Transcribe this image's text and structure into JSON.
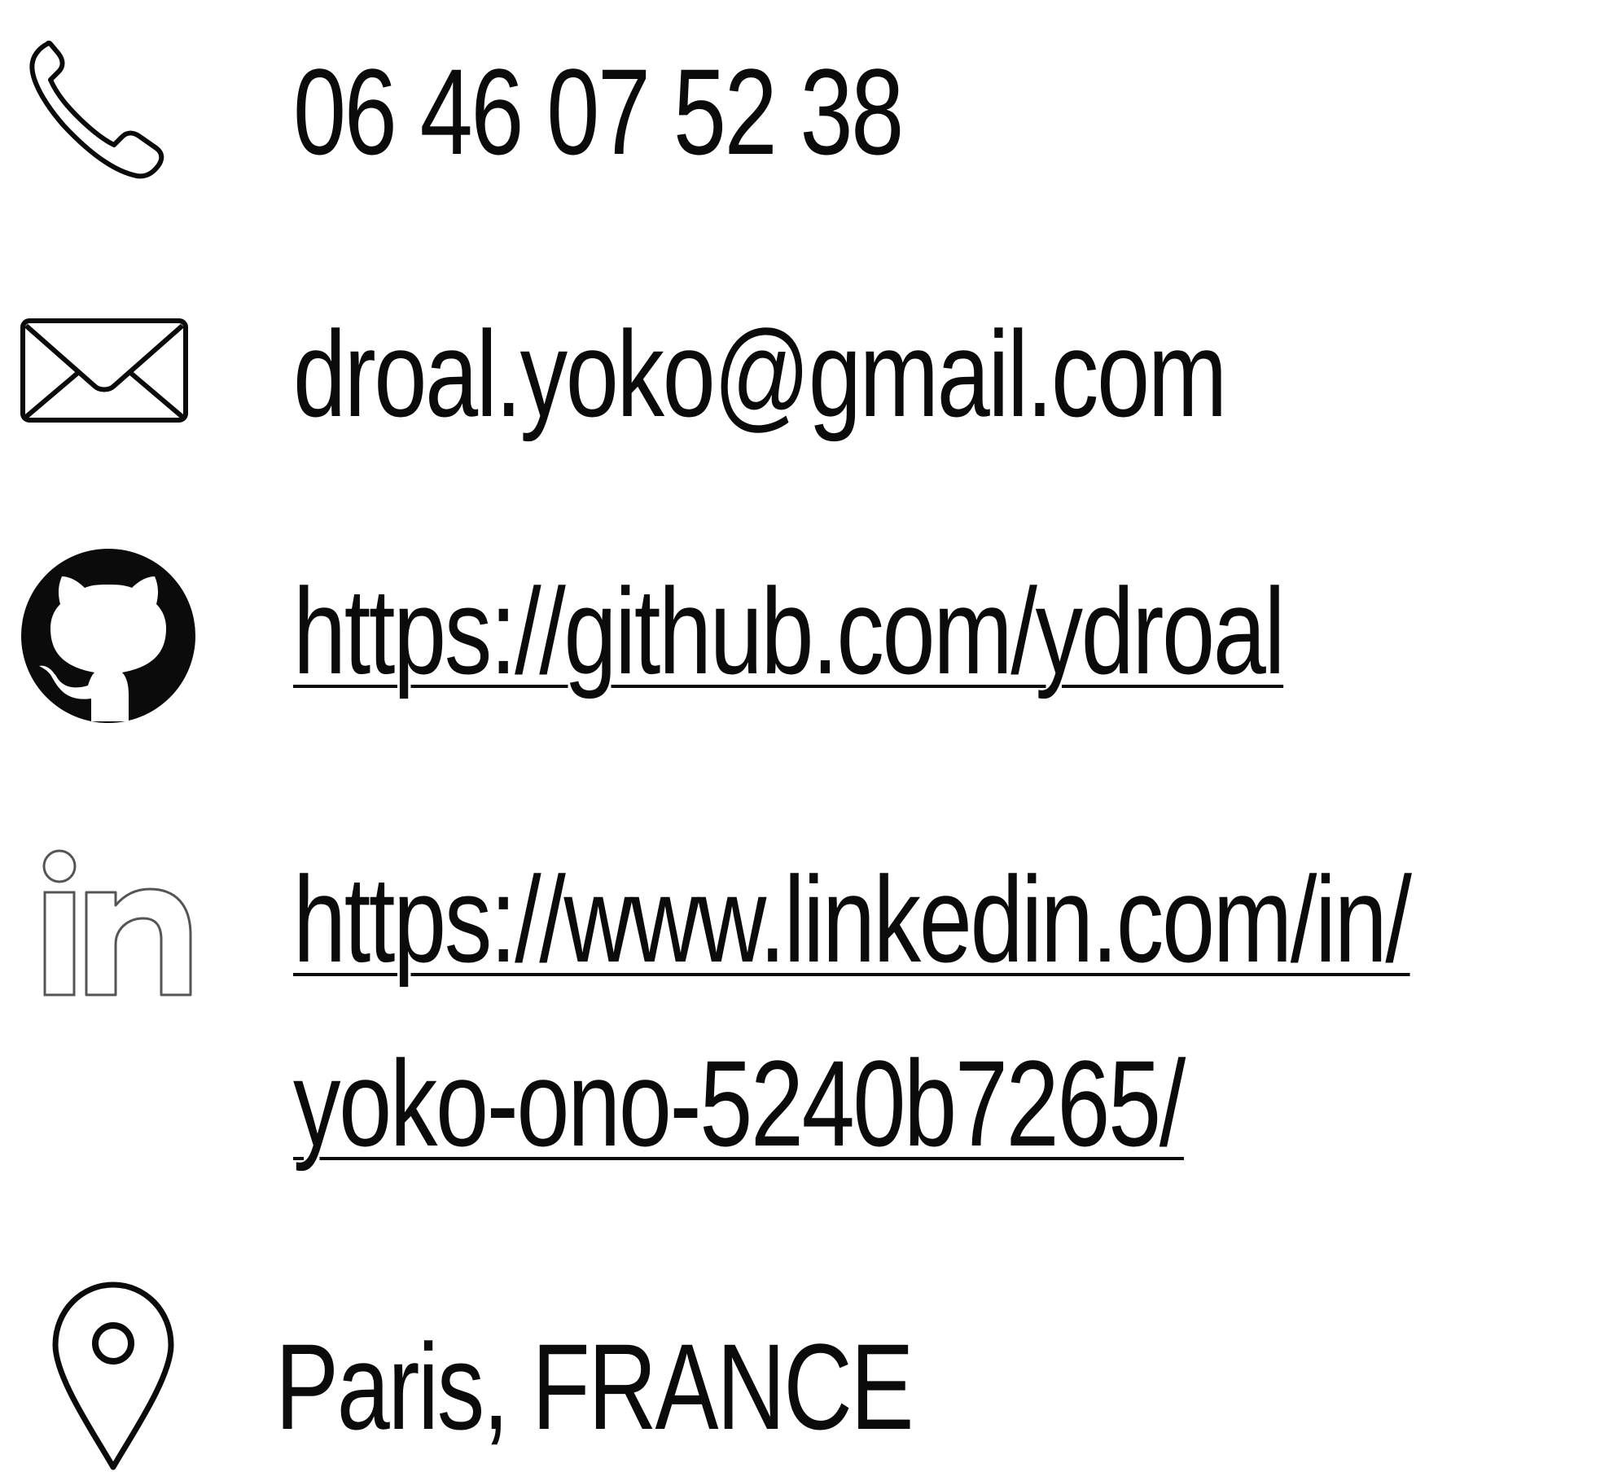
{
  "contact": {
    "phone": {
      "icon": "phone-icon",
      "text": "06 46 07 52 38"
    },
    "email": {
      "icon": "envelope-icon",
      "text": "droal.yoko@gmail.com"
    },
    "github": {
      "icon": "github-icon",
      "text": "https://github.com/ydroal"
    },
    "linkedin": {
      "icon": "linkedin-icon",
      "line1": "https://www.linkedin.com/in/",
      "line2": "yoko-ono-5240b7265/"
    },
    "location": {
      "icon": "map-pin-icon",
      "text": "Paris, FRANCE"
    }
  },
  "colors": {
    "text": "#0b0b0b",
    "background": "#ffffff",
    "linkedin_outline": "#555555"
  }
}
